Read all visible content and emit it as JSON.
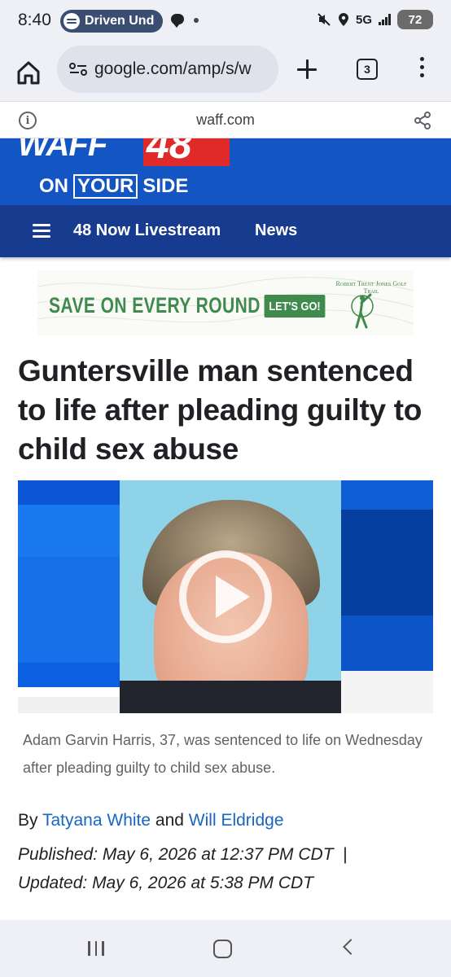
{
  "status_bar": {
    "time": "8:40",
    "notification_pill": "Driven Und",
    "network": "5G",
    "battery": "72"
  },
  "browser": {
    "url": "google.com/amp/s/w",
    "tab_count": "3",
    "amp_domain": "waff.com"
  },
  "station": {
    "logo_name": "WAFF",
    "logo_number": "48",
    "tagline_on": "ON",
    "tagline_your": "YOUR",
    "tagline_side": "SIDE"
  },
  "nav": {
    "items": [
      "48 Now Livestream",
      "News"
    ]
  },
  "ad": {
    "headline": "SAVE ON EVERY ROUND",
    "button": "LET'S GO!",
    "brand": "Robert Trent Jones Golf Trail"
  },
  "article": {
    "headline": "Guntersville man sentenced to life after pleading guilty to child sex abuse",
    "caption": "Adam Garvin Harris, 37, was sentenced to life on Wednesday after pleading guilty to child sex abuse.",
    "by": "By",
    "authors": [
      "Tatyana White",
      "Will Eldridge"
    ],
    "and": "and",
    "published": "Published: May 6, 2026 at 12:37 PM CDT",
    "separator": "|",
    "updated": "Updated: May 6, 2026 at 5:38 PM CDT"
  },
  "colors": {
    "station_blue": "#1455c4",
    "nav_blue": "#173b8f",
    "logo_red": "#e02a2a",
    "link_blue": "#1766c2",
    "ad_green": "#3f8a4c"
  }
}
